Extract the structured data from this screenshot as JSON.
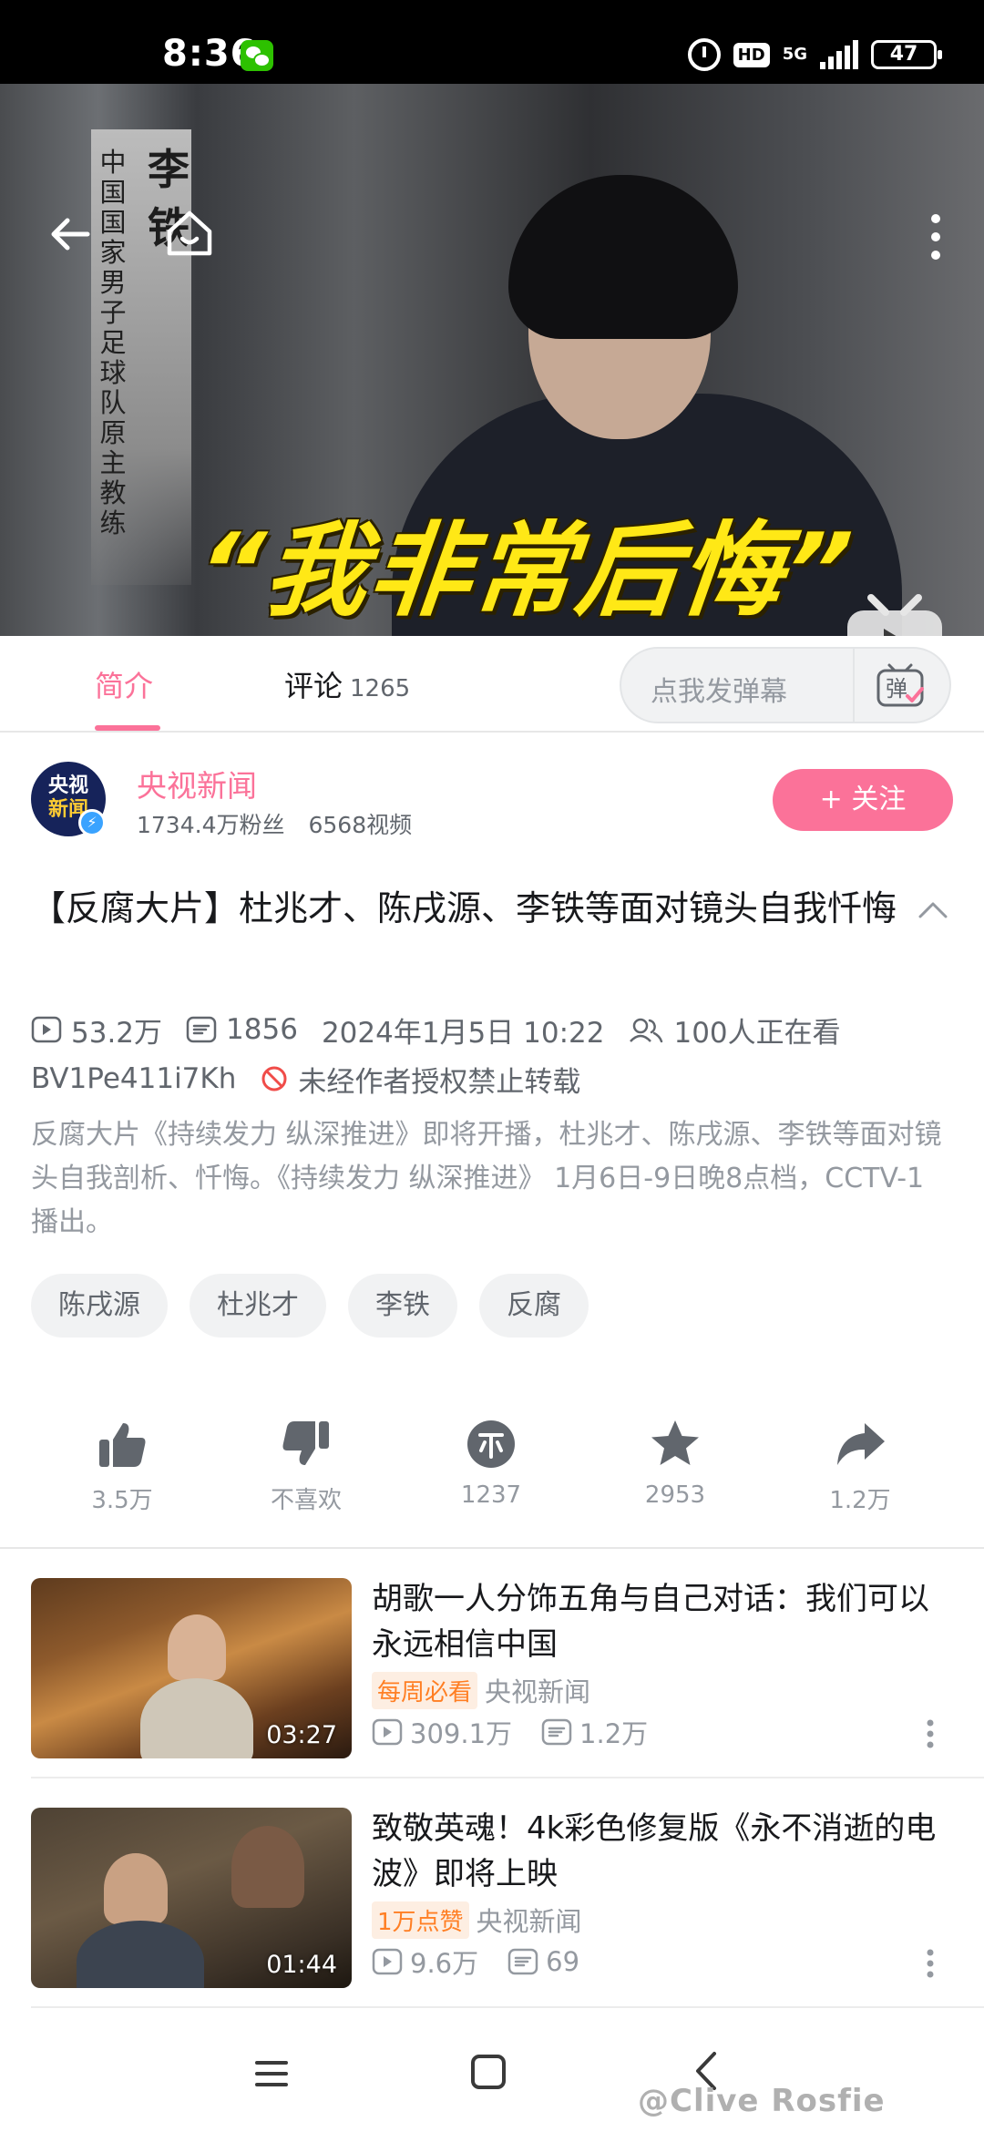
{
  "status_bar": {
    "time": "8:36",
    "network": "5G",
    "hd": "HD",
    "battery": "47"
  },
  "video": {
    "banner_name": "李铁",
    "banner_title": "中国国家男子足球队原主教练",
    "caption": "“我非常后悔”"
  },
  "tabs": {
    "intro_label": "简介",
    "comment_label": "评论",
    "comment_count": "1265",
    "danmaku_placeholder": "点我发弹幕",
    "danmaku_icon_label": "弹"
  },
  "uploader": {
    "avatar_line1": "央视",
    "avatar_line2": "新闻",
    "name": "央视新闻",
    "fans": "1734.4万粉丝",
    "videos": "6568视频",
    "follow_label": "+ 关注"
  },
  "detail": {
    "title": "【反腐大片】杜兆才、陈戌源、李铁等面对镜头自我忏悔",
    "views": "53.2万",
    "danmaku_count": "1856",
    "date": "2024年1月5日 10:22",
    "watching": "100人正在看",
    "bvid": "BV1Pe411i7Kh",
    "copyright": "未经作者授权禁止转载",
    "description": "反腐大片《持续发力 纵深推进》即将开播，杜兆才、陈戌源、李铁等面对镜头自我剖析、忏悔。《持续发力 纵深推进》 1月6日-9日晚8点档，CCTV-1播出。",
    "tags": [
      "陈戌源",
      "杜兆才",
      "李铁",
      "反腐"
    ]
  },
  "actions": {
    "like": "3.5万",
    "dislike": "不喜欢",
    "coin": "1237",
    "favorite": "2953",
    "share": "1.2万"
  },
  "related": [
    {
      "title": "胡歌一人分饰五角与自己对话：我们可以永远相信中国",
      "badge": "每周必看",
      "author": "央视新闻",
      "views": "309.1万",
      "danmaku": "1.2万",
      "duration": "03:27"
    },
    {
      "title": "致敬英魂！4k彩色修复版《永不消逝的电波》即将上映",
      "badge": "1万点赞",
      "author": "央视新闻",
      "views": "9.6万",
      "danmaku": "69",
      "duration": "01:44"
    }
  ],
  "watermark": "@Clive Rosfie",
  "colors": {
    "accent": "#fb7299",
    "badge_orange": "#ff7f24",
    "caption_yellow": "#ffe816"
  }
}
